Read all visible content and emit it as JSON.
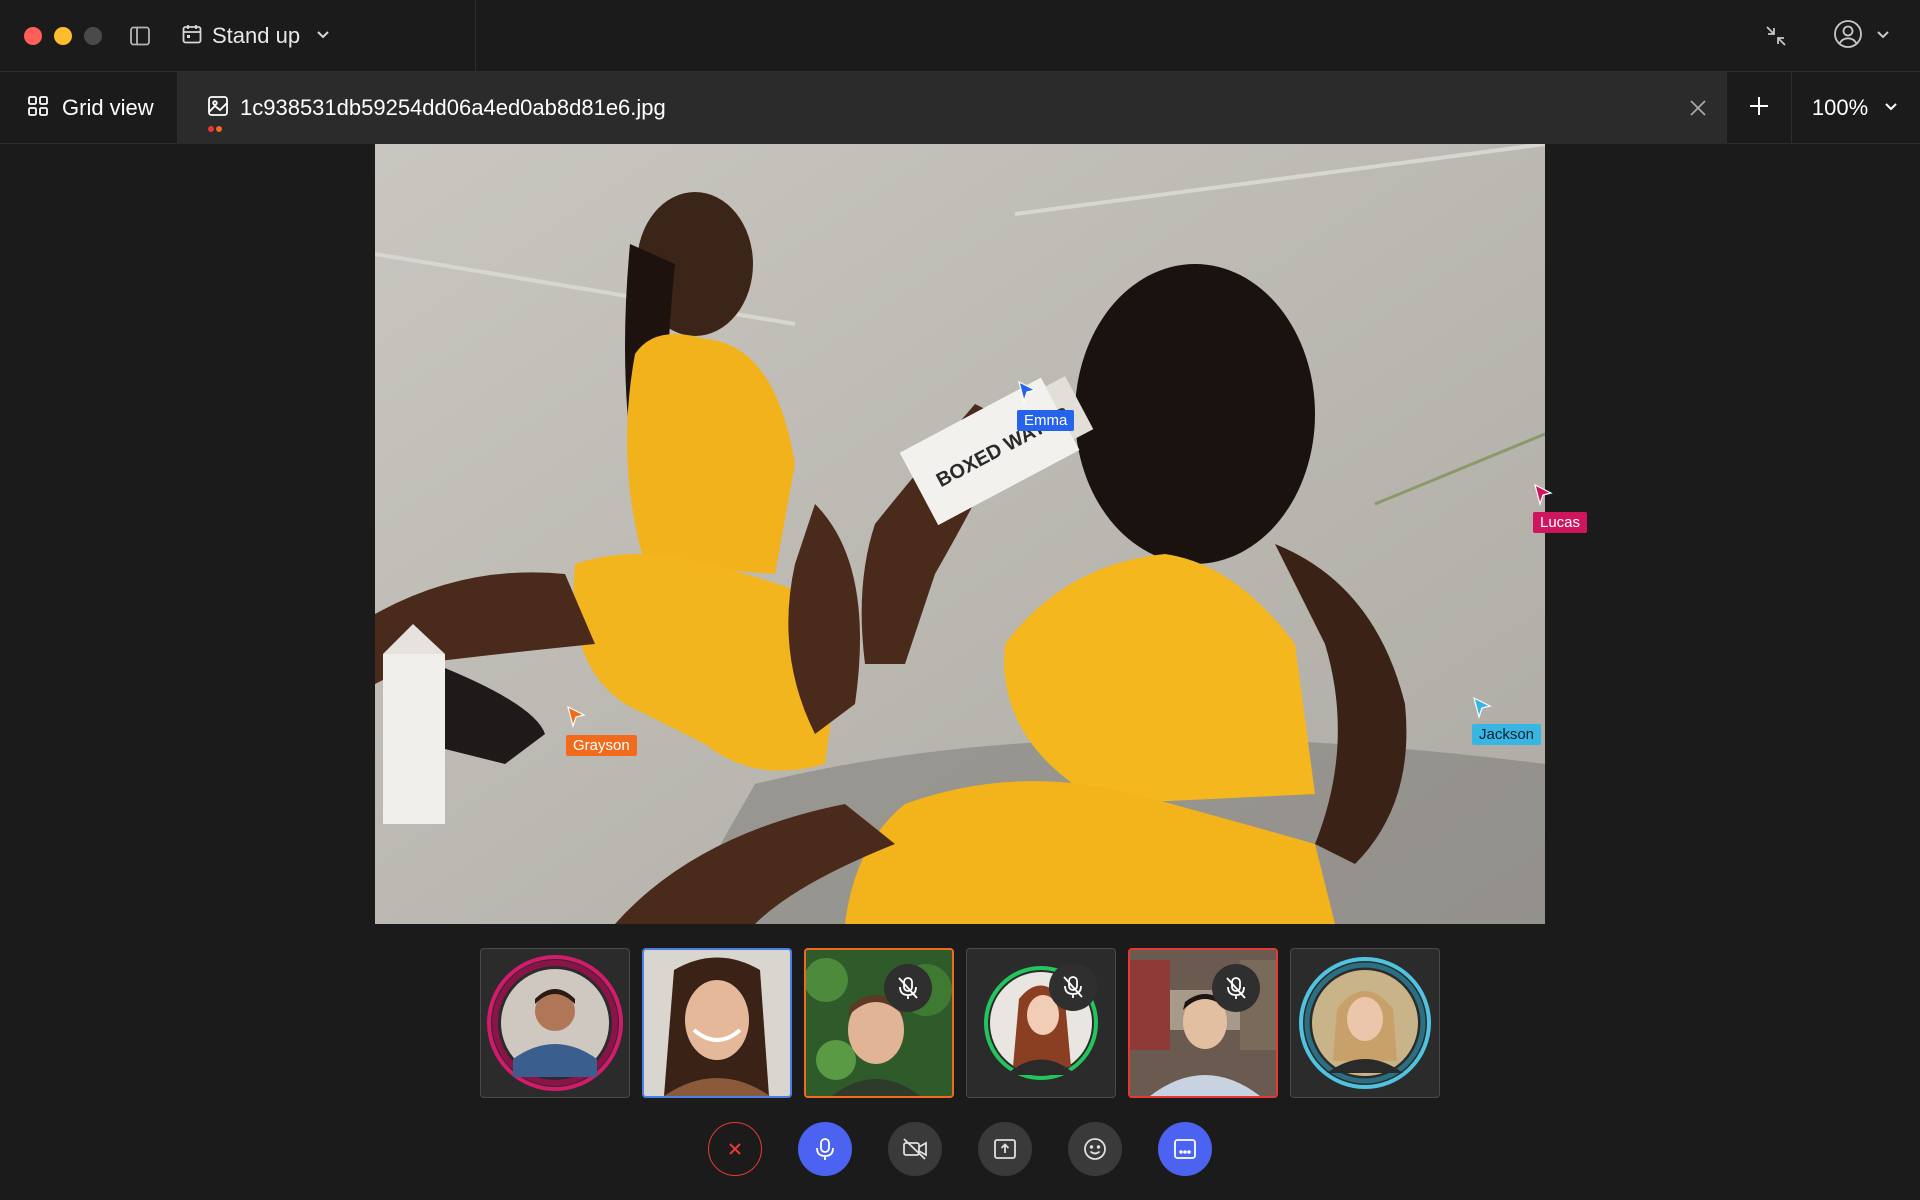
{
  "window": {
    "meeting_title": "Stand up"
  },
  "tabs": {
    "grid_view_label": "Grid view",
    "file_name": "1c938531db59254dd06a4ed0ab8d81e6.jpg",
    "zoom": "100%"
  },
  "cursors": [
    {
      "name": "Emma",
      "color": "#2563eb"
    },
    {
      "name": "Lucas",
      "color": "#d0155f"
    },
    {
      "name": "Jackson",
      "color": "#38b6e3"
    },
    {
      "name": "Grayson",
      "color": "#f26b1d"
    }
  ],
  "participants": [
    {
      "state": "speaking",
      "muted": false,
      "ring_color": "#d41a6a",
      "icon": "avatar"
    },
    {
      "state": "video",
      "muted": false,
      "ring_color": "#4a7fe8",
      "icon": "avatar"
    },
    {
      "state": "video",
      "muted": true,
      "ring_color": "#f26b1d",
      "icon": "mic-off-icon"
    },
    {
      "state": "avatar",
      "muted": true,
      "ring_color": "#22c55e",
      "icon": "mic-off-icon"
    },
    {
      "state": "video",
      "muted": true,
      "ring_color": "#e53935",
      "icon": "mic-off-icon"
    },
    {
      "state": "speaking",
      "muted": false,
      "ring_color": "#4fc3e0",
      "icon": "avatar"
    }
  ],
  "controls": [
    {
      "name": "leave-call",
      "icon": "close-icon",
      "color": "#e53935"
    },
    {
      "name": "microphone",
      "icon": "mic-icon",
      "color": "#4b63f0"
    },
    {
      "name": "camera",
      "icon": "camera-off-icon",
      "color": "#3a3a3a"
    },
    {
      "name": "share-screen",
      "icon": "share-icon",
      "color": "#3a3a3a"
    },
    {
      "name": "reactions",
      "icon": "emoji-icon",
      "color": "#3a3a3a"
    },
    {
      "name": "captions",
      "icon": "captions-icon",
      "color": "#4b63f0"
    }
  ],
  "colors": {
    "accent": "#4b63f0",
    "background": "#1b1b1b",
    "tab_active": "#2b2b2b"
  }
}
